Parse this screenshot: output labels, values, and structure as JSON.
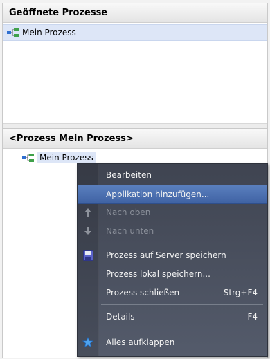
{
  "open_processes": {
    "title": "Geöffnete Prozesse",
    "items": [
      {
        "label": "Mein Prozess",
        "selected": true
      }
    ]
  },
  "process_panel": {
    "title": "<Prozess Mein Prozess>",
    "tree_item": "Mein Prozess"
  },
  "context_menu": {
    "items": [
      {
        "label": "Bearbeiten",
        "enabled": true
      },
      {
        "label": "Applikation hinzufügen...",
        "enabled": true,
        "highlighted": true
      },
      {
        "label": "Nach oben",
        "enabled": false,
        "icon": "arrow-up-icon"
      },
      {
        "label": "Nach unten",
        "enabled": false,
        "icon": "arrow-down-icon"
      },
      {
        "label": "Prozess auf Server speichern",
        "enabled": true,
        "icon": "save-icon"
      },
      {
        "label": "Prozess lokal speichern...",
        "enabled": true
      },
      {
        "label": "Prozess schließen",
        "enabled": true,
        "shortcut": "Strg+F4"
      },
      {
        "label": "Details",
        "enabled": true,
        "shortcut": "F4"
      },
      {
        "label": "Alles aufklappen",
        "enabled": true,
        "icon": "star-icon"
      }
    ]
  },
  "colors": {
    "menu_background": "#4a505e",
    "menu_highlight": "#4a6fb0",
    "selection": "#dde6f7"
  }
}
